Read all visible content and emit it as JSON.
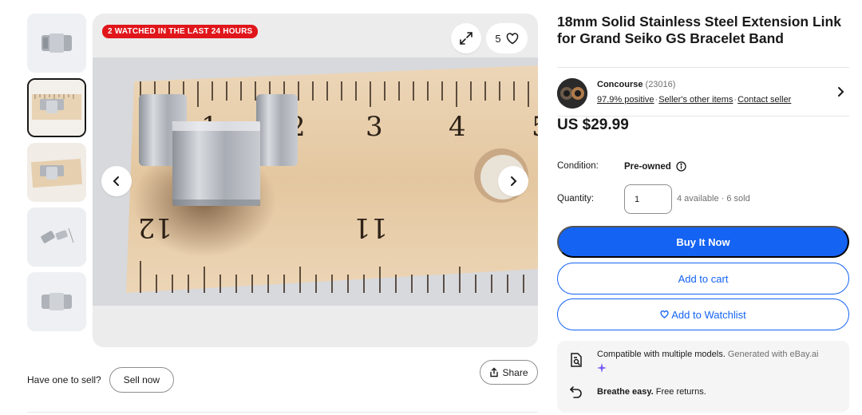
{
  "gallery": {
    "thumbnails": [
      {
        "alt": "link-top-view"
      },
      {
        "alt": "link-on-ruler",
        "selected": true
      },
      {
        "alt": "link-on-ruler-angle"
      },
      {
        "alt": "two-links-side"
      },
      {
        "alt": "link-front-view"
      }
    ],
    "badge": "2 WATCHED IN THE LAST 24 HOURS",
    "watch_count": "5",
    "ruler_numbers": [
      "1",
      "2",
      "3",
      "4",
      "5",
      "12",
      "11"
    ],
    "icons": {
      "expand": "expand-icon",
      "heart": "heart-icon",
      "prev": "chevron-left-icon",
      "next": "chevron-right-icon"
    }
  },
  "sell": {
    "prompt": "Have one to sell?",
    "button": "Sell now"
  },
  "share": {
    "label": "Share"
  },
  "listing": {
    "title": "18mm Solid Stainless Steel Extension Link for Grand Seiko GS Bracelet Band",
    "seller": {
      "name": "Concourse",
      "feedback_count": "(23016)",
      "positive": "97.9% positive",
      "other_items": "Seller's other items",
      "contact": "Contact seller"
    },
    "price": "US $29.99",
    "condition_label": "Condition:",
    "condition_value": "Pre-owned",
    "quantity_label": "Quantity:",
    "quantity_value": "1",
    "availability": "4 available · 6 sold",
    "buttons": {
      "buy": "Buy It Now",
      "cart": "Add to cart",
      "watchlist": "Add to Watchlist"
    },
    "info": {
      "compat_bold": "Compatible with multiple models.",
      "compat_note": "Generated with eBay.ai",
      "returns_bold": "Breathe easy.",
      "returns_note": "Free returns."
    }
  },
  "colors": {
    "accent": "#1463f3",
    "badge": "#e0161b",
    "text": "#191919",
    "muted": "#707070"
  }
}
